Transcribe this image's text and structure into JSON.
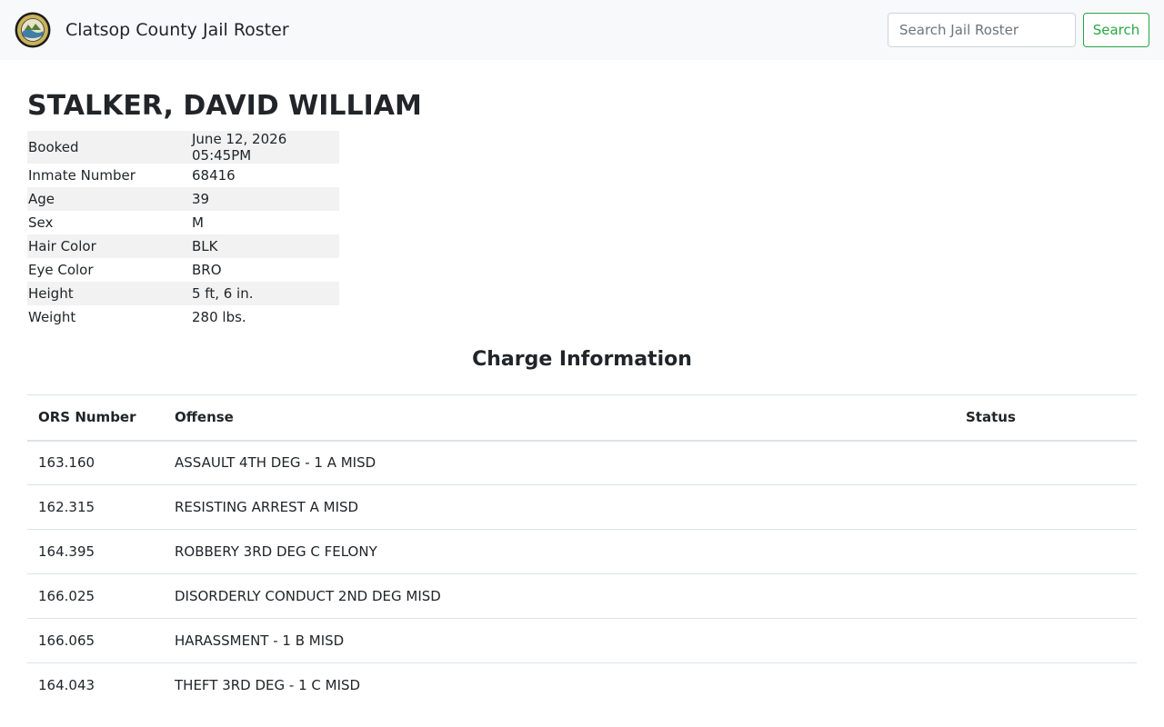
{
  "navbar": {
    "title": "Clatsop County Jail Roster",
    "search_placeholder": "Search Jail Roster",
    "search_button": "Search",
    "seal_icon": "county-seal-icon"
  },
  "inmate": {
    "name": "STALKER, DAVID WILLIAM",
    "details": [
      {
        "label": "Booked",
        "value": "June 12, 2026 05:45PM"
      },
      {
        "label": "Inmate Number",
        "value": "68416"
      },
      {
        "label": "Age",
        "value": "39"
      },
      {
        "label": "Sex",
        "value": "M"
      },
      {
        "label": "Hair Color",
        "value": "BLK"
      },
      {
        "label": "Eye Color",
        "value": "BRO"
      },
      {
        "label": "Height",
        "value": "5 ft, 6 in."
      },
      {
        "label": "Weight",
        "value": "280 lbs."
      }
    ]
  },
  "charges": {
    "title": "Charge Information",
    "headers": {
      "ors": "ORS Number",
      "offense": "Offense",
      "status": "Status"
    },
    "rows": [
      {
        "ors": "163.160",
        "offense": "ASSAULT 4TH DEG - 1 A MISD",
        "status": ""
      },
      {
        "ors": "162.315",
        "offense": "RESISTING ARREST A MISD",
        "status": ""
      },
      {
        "ors": "164.395",
        "offense": "ROBBERY 3RD DEG C FELONY",
        "status": ""
      },
      {
        "ors": "166.025",
        "offense": "DISORDERLY CONDUCT 2ND DEG MISD",
        "status": ""
      },
      {
        "ors": "166.065",
        "offense": "HARASSMENT - 1 B MISD",
        "status": ""
      },
      {
        "ors": "164.043",
        "offense": "THEFT 3RD DEG - 1 C MISD",
        "status": ""
      }
    ]
  },
  "colors": {
    "navbar_bg": "#f8f9fa",
    "accent_green": "#28a745",
    "stripe": "#f2f2f2",
    "border": "#dee2e6"
  }
}
